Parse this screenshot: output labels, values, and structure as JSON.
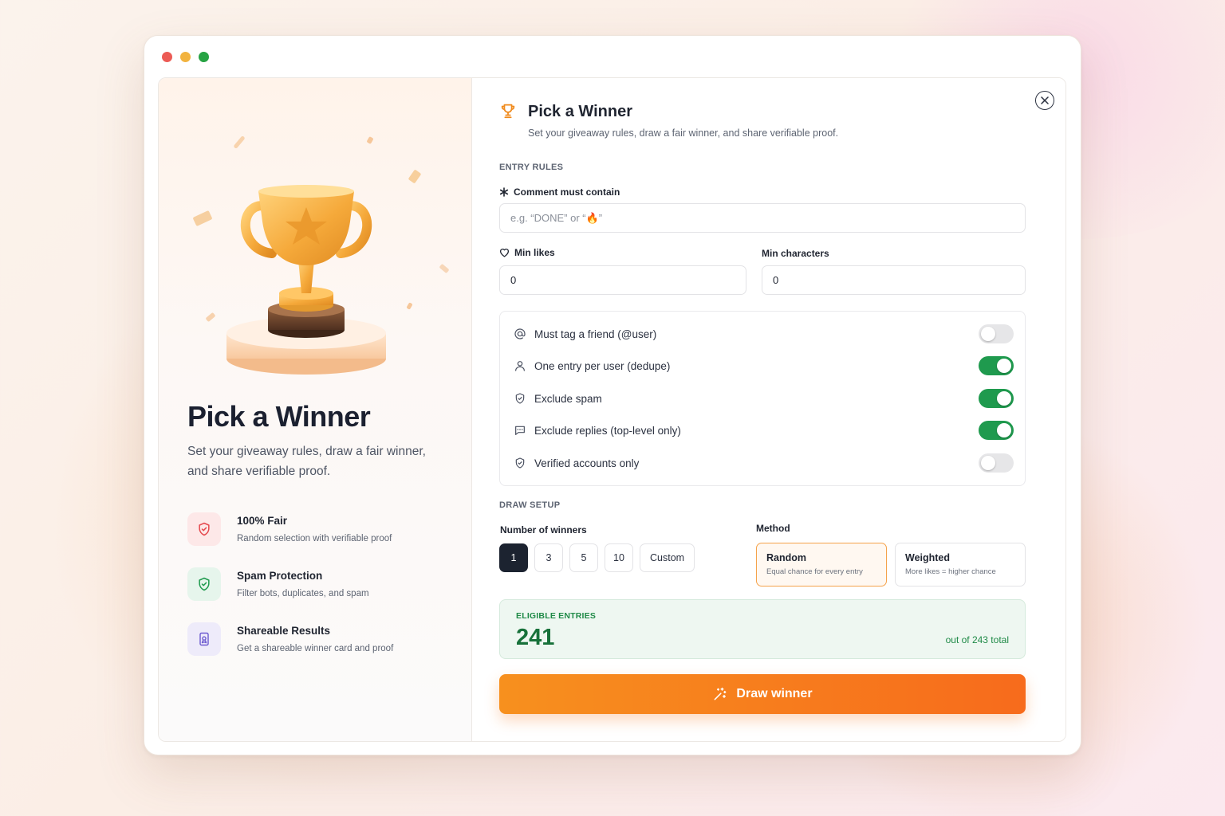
{
  "window": {
    "dots": [
      "#ec5b55",
      "#f2b33f",
      "#27a344"
    ]
  },
  "left": {
    "title": "Pick a Winner",
    "subtitle": "Set your giveaway rules, draw a fair winner, and share verifiable proof.",
    "features": [
      {
        "title": "100% Fair",
        "desc": "Random selection with verifiable proof",
        "icon": "shield-check-icon",
        "color": "#e5484d"
      },
      {
        "title": "Spam Protection",
        "desc": "Filter bots, duplicates, and spam",
        "icon": "shield-check-icon",
        "color": "#1f9a4e"
      },
      {
        "title": "Shareable Results",
        "desc": "Get a shareable winner card and proof",
        "icon": "share-card-icon",
        "color": "#6d5bd0"
      }
    ]
  },
  "header": {
    "title": "Pick a Winner",
    "subtitle": "Set your giveaway rules, draw a fair winner, and share verifiable proof."
  },
  "entry_rules": {
    "label": "ENTRY RULES",
    "comment_label": "Comment must contain",
    "comment_placeholder": "e.g. “DONE” or “🔥”",
    "min_likes_label": "Min likes",
    "min_likes_value": "0",
    "min_chars_label": "Min characters",
    "min_chars_value": "0"
  },
  "toggles": [
    {
      "label": "Must tag a friend (@user)",
      "icon": "at-icon",
      "on": false
    },
    {
      "label": "One entry per user (dedupe)",
      "icon": "user-icon",
      "on": true
    },
    {
      "label": "Exclude spam",
      "icon": "shield-check-icon",
      "on": true
    },
    {
      "label": "Exclude replies (top-level only)",
      "icon": "message-icon",
      "on": true
    },
    {
      "label": "Verified accounts only",
      "icon": "shield-check-icon",
      "on": false
    }
  ],
  "draw_setup": {
    "label": "DRAW SETUP",
    "winners_label": "Number of winners",
    "winner_options": [
      "1",
      "3",
      "5",
      "10",
      "Custom"
    ],
    "selected_winners": "1",
    "method_label": "Method",
    "methods": [
      {
        "title": "Random",
        "desc": "Equal chance for every entry",
        "active": true
      },
      {
        "title": "Weighted",
        "desc": "More likes = higher chance",
        "active": false
      }
    ]
  },
  "eligible": {
    "label": "ELIGIBLE ENTRIES",
    "count": "241",
    "total": "out of 243 total"
  },
  "draw_button": {
    "label": "Draw winner"
  },
  "colors": {
    "accent": "#f7901e",
    "success": "#1f9a4e",
    "dark": "#1c2330"
  }
}
